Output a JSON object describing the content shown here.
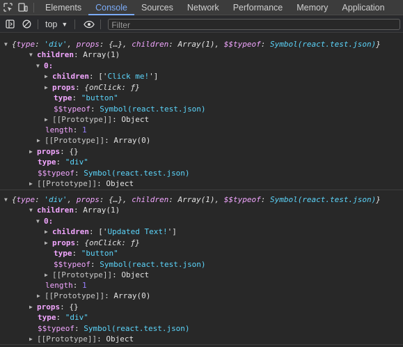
{
  "tabs": [
    {
      "label": "Elements",
      "active": false
    },
    {
      "label": "Console",
      "active": true
    },
    {
      "label": "Sources",
      "active": false
    },
    {
      "label": "Network",
      "active": false
    },
    {
      "label": "Performance",
      "active": false
    },
    {
      "label": "Memory",
      "active": false
    },
    {
      "label": "Application",
      "active": false
    }
  ],
  "toolbar": {
    "context_label": "top",
    "filter_placeholder": "Filter",
    "icons": [
      "sidebar-toggle-icon",
      "clear-console-icon",
      "eye-icon"
    ]
  },
  "colors": {
    "accent": "#7cacf8",
    "key": "#f2a6ff",
    "string": "#5cd5fb",
    "number": "#9980ff"
  },
  "entries": [
    {
      "summary": {
        "open": "{",
        "type_key": "type",
        "type_val": "'div'",
        "props_key": "props",
        "props_val": "{…}",
        "children_key": "children",
        "children_val": "Array(1)",
        "typeof_key": "$$typeof",
        "typeof_val": "Symbol(react.test.json)",
        "close": "}"
      },
      "children_label": "children",
      "children_value": "Array(1)",
      "index_label": "0:",
      "inner_children_label": "children",
      "inner_children_value_open": "['",
      "inner_children_text": "Click me!",
      "inner_children_value_close": "']",
      "inner_props_label": "props",
      "inner_props_value": "{onClick: ƒ}",
      "inner_type_label": "type",
      "inner_type_value": "\"button\"",
      "inner_typeof_label": "$$typeof",
      "inner_typeof_value": "Symbol(react.test.json)",
      "inner_proto_label": "[[Prototype]]",
      "inner_proto_value": "Object",
      "length_label": "length",
      "length_value": "1",
      "array_proto_label": "[[Prototype]]",
      "array_proto_value": "Array(0)",
      "props_label": "props",
      "props_value": "{}",
      "type_label": "type",
      "type_value": "\"div\"",
      "typeof_label": "$$typeof",
      "typeof_value": "Symbol(react.test.json)",
      "proto_label": "[[Prototype]]",
      "proto_value": "Object"
    },
    {
      "summary": {
        "open": "{",
        "type_key": "type",
        "type_val": "'div'",
        "props_key": "props",
        "props_val": "{…}",
        "children_key": "children",
        "children_val": "Array(1)",
        "typeof_key": "$$typeof",
        "typeof_val": "Symbol(react.test.json)",
        "close": "}"
      },
      "children_label": "children",
      "children_value": "Array(1)",
      "index_label": "0:",
      "inner_children_label": "children",
      "inner_children_value_open": "['",
      "inner_children_text": "Updated Text!",
      "inner_children_value_close": "']",
      "inner_props_label": "props",
      "inner_props_value": "{onClick: ƒ}",
      "inner_type_label": "type",
      "inner_type_value": "\"button\"",
      "inner_typeof_label": "$$typeof",
      "inner_typeof_value": "Symbol(react.test.json)",
      "inner_proto_label": "[[Prototype]]",
      "inner_proto_value": "Object",
      "length_label": "length",
      "length_value": "1",
      "array_proto_label": "[[Prototype]]",
      "array_proto_value": "Array(0)",
      "props_label": "props",
      "props_value": "{}",
      "type_label": "type",
      "type_value": "\"div\"",
      "typeof_label": "$$typeof",
      "typeof_value": "Symbol(react.test.json)",
      "proto_label": "[[Prototype]]",
      "proto_value": "Object"
    }
  ]
}
